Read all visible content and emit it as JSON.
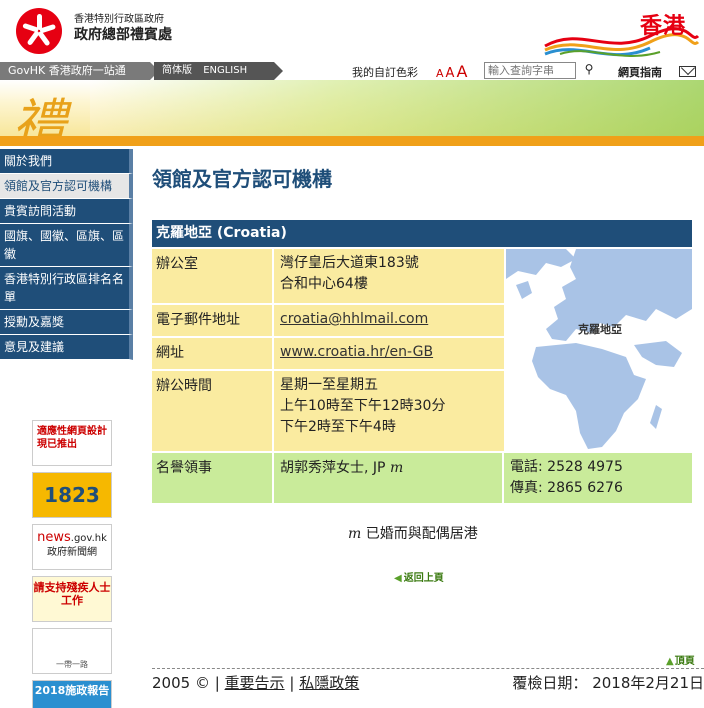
{
  "header": {
    "dept_line1": "香港特別行政區政府",
    "dept_line2": "政府總部禮賓處",
    "brand": "香港"
  },
  "topbar": {
    "govhk": "GovHK 香港政府一站通",
    "lang_simplified": "简体版",
    "lang_english": "ENGLISH",
    "color_option": "我的自訂色彩",
    "font_small": "A",
    "font_medium": "A",
    "font_large": "A",
    "search_placeholder": "輸入查詢字串",
    "sitemap": "網頁指南"
  },
  "banner": {
    "char": "禮"
  },
  "nav": {
    "items": [
      {
        "label": "關於我們"
      },
      {
        "label": "領館及官方認可機構"
      },
      {
        "label": "貴賓訪問活動"
      },
      {
        "label": "國旗、國徽、區旗、區徽"
      },
      {
        "label": "香港特別行政區排名名單"
      },
      {
        "label": "授勳及嘉獎"
      },
      {
        "label": "意見及建議"
      }
    ]
  },
  "promos": {
    "p1": "適應性網頁設計現已推出",
    "p2": "1823",
    "p3_a": "news",
    "p3_b": ".gov.hk",
    "p3_c": "政府新聞網",
    "p4": "請支持殘疾人士工作",
    "p5": "一帶一路",
    "p6": "2018施政報告"
  },
  "main": {
    "title": "領館及官方認可機構",
    "country": "克羅地亞 (Croatia)",
    "office_label": "辦公室",
    "office_line1": "灣仔皇后大道東183號",
    "office_line2": "合和中心64樓",
    "email_label": "電子郵件地址",
    "email": "croatia@hhlmail.com",
    "web_label": "網址",
    "web": "www.croatia.hr/en-GB",
    "hours_label": "辦公時間",
    "hours_line1": "星期一至星期五",
    "hours_line2": "上午10時至下午12時30分",
    "hours_line3": "下午2時至下午4時",
    "map_label": "克羅地亞",
    "consul_label": "名譽領事",
    "consul_name": "胡郭秀萍女士, JP",
    "consul_mark": "m",
    "tel": "電話: 2528 4975",
    "fax": "傳真: 2865 6276",
    "note_mark": "m",
    "note_text": "已婚而與配偶居港",
    "back": "返回上頁"
  },
  "footer": {
    "totop": "頂頁",
    "copyright": "2005 © |",
    "notice": "重要告示",
    "sep": "|",
    "privacy": "私隱政策",
    "review": "覆檢日期： 2018年2月21日"
  },
  "colors": {
    "nav_bg": "#1f4e79",
    "table_yellow": "#faeba0",
    "table_green": "#c9eb9a",
    "brand_red": "#e60012"
  }
}
